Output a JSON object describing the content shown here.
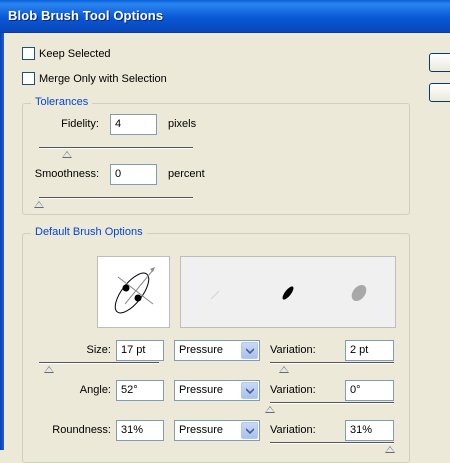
{
  "window": {
    "title": "Blob Brush Tool Options"
  },
  "options": {
    "keep_selected": {
      "label": "Keep Selected",
      "checked": false
    },
    "merge_only": {
      "label": "Merge Only with Selection",
      "checked": false
    }
  },
  "tolerances": {
    "title": "Tolerances",
    "fidelity": {
      "label": "Fidelity:",
      "value": "4",
      "unit": "pixels"
    },
    "smoothness": {
      "label": "Smoothness:",
      "value": "0",
      "unit": "percent"
    }
  },
  "brush": {
    "title": "Default Brush Options",
    "size": {
      "label": "Size:",
      "value": "17 pt",
      "mode": "Pressure",
      "variation_label": "Variation:",
      "variation": "2 pt"
    },
    "angle": {
      "label": "Angle:",
      "value": "52°",
      "mode": "Pressure",
      "variation_label": "Variation:",
      "variation": "0°"
    },
    "roundness": {
      "label": "Roundness:",
      "value": "31%",
      "mode": "Pressure",
      "variation_label": "Variation:",
      "variation": "31%"
    }
  },
  "colors": {
    "title_bar": "#0a58d6",
    "group_label": "#0046d5",
    "window_bg": "#ece9d8"
  }
}
